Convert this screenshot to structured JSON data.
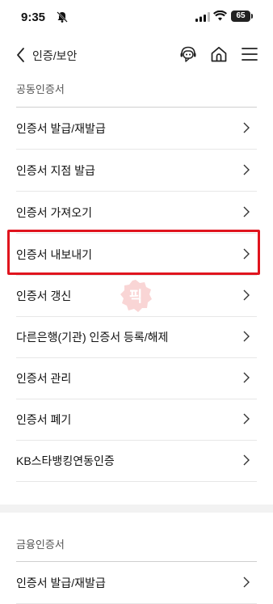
{
  "status_bar": {
    "time": "9:35",
    "battery": "65"
  },
  "header": {
    "title": "인증/보안"
  },
  "sections": [
    {
      "label": "공동인증서",
      "items": [
        {
          "label": "인증서 발급/재발급"
        },
        {
          "label": "인증서 지점 발급"
        },
        {
          "label": "인증서 가져오기"
        },
        {
          "label": "인증서 내보내기"
        },
        {
          "label": "인증서 갱신"
        },
        {
          "label": "다른은행(기관) 인증서 등록/해제"
        },
        {
          "label": "인증서 관리"
        },
        {
          "label": "인증서 폐기"
        },
        {
          "label": "KB스타뱅킹연동인증"
        }
      ]
    },
    {
      "label": "금융인증서",
      "items": [
        {
          "label": "인증서 발급/재발급"
        }
      ]
    }
  ],
  "watermark": {
    "text": "픽"
  },
  "colors": {
    "highlight": "#e0141e",
    "watermark": "#f08a8a"
  }
}
